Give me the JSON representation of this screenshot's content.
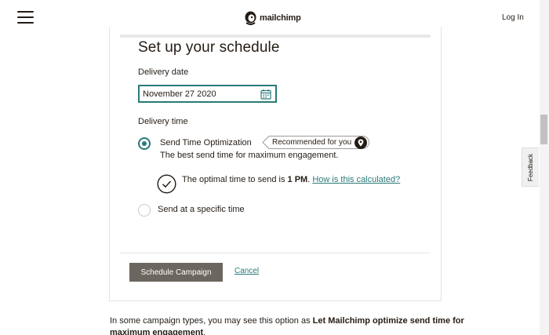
{
  "header": {
    "logo_text": "mailchimp",
    "login_label": "Log In"
  },
  "schedule": {
    "title": "Set up your schedule",
    "delivery_date_label": "Delivery date",
    "delivery_date_value": "November 27 2020",
    "delivery_time_label": "Delivery time",
    "options": {
      "sto_label": "Send Time Optimization",
      "sto_badge": "Recommended for you",
      "sto_description": "The best send time for maximum engagement.",
      "optimal_prefix": "The optimal time to send is ",
      "optimal_time": "1 PM",
      "optimal_suffix": ". ",
      "optimal_link": "How is this calculated?",
      "specific_label": "Send at a specific time"
    },
    "selected_option": "sto",
    "schedule_button": "Schedule Campaign",
    "cancel_button": "Cancel"
  },
  "note": {
    "prefix": "In some campaign types, you may see this option as ",
    "bold": "Let Mailchimp optimize send time for maximum engagement",
    "suffix": "."
  },
  "feedback_label": "Feedback",
  "colors": {
    "accent": "#2a7a78",
    "button_bg": "#6c6660",
    "text": "#241c15"
  },
  "icons": {
    "menu": "hamburger-icon",
    "calendar": "calendar-icon",
    "badge": "location-pin-icon",
    "check": "checkmark-circle-icon"
  }
}
